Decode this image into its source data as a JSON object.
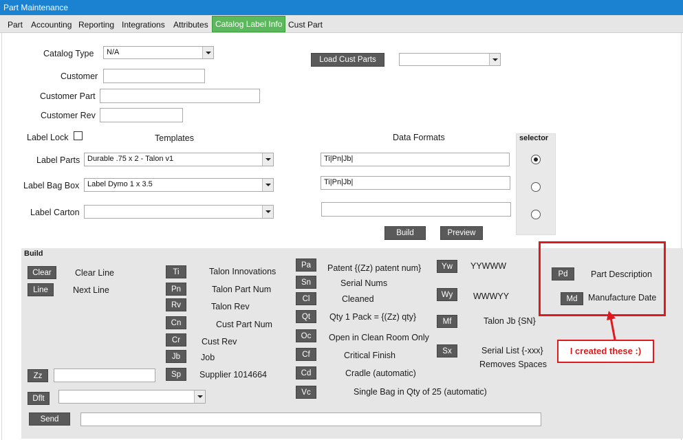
{
  "window": {
    "title": "Part Maintenance"
  },
  "tabs": [
    {
      "label": "Part"
    },
    {
      "label": "Accounting"
    },
    {
      "label": "Reporting"
    },
    {
      "label": "Integrations"
    },
    {
      "label": "Attributes"
    },
    {
      "label": "Catalog Label Info",
      "active": true
    },
    {
      "label": "Cust Part"
    }
  ],
  "form": {
    "catalog_type": {
      "label": "Catalog Type",
      "value": "N/A"
    },
    "customer": {
      "label": "Customer",
      "value": ""
    },
    "customer_part": {
      "label": "Customer Part",
      "value": ""
    },
    "customer_rev": {
      "label": "Customer Rev",
      "value": ""
    },
    "load_cust_parts": {
      "label": "Load Cust Parts",
      "value": ""
    },
    "label_lock": {
      "label": "Label Lock",
      "checked": false
    },
    "templates_header": "Templates",
    "data_formats_header": "Data Formats",
    "selector_header": "selector",
    "label_parts": {
      "label": "Label Parts",
      "template": "Durable .75 x 2 - Talon v1",
      "format": "Ti|Pn|Jb|"
    },
    "label_bag_box": {
      "label": "Label Bag Box",
      "template": "Label Dymo 1 x 3.5",
      "format": "Ti|Pn|Jb|"
    },
    "label_carton": {
      "label": "Label Carton",
      "template": "",
      "format": ""
    },
    "selected_index": 0,
    "build_button": "Build",
    "preview_button": "Preview"
  },
  "build": {
    "title": "Build",
    "col1": [
      {
        "code": "Clear",
        "desc": "Clear Line"
      },
      {
        "code": "Line",
        "desc": "Next Line"
      }
    ],
    "col2": [
      {
        "code": "Ti",
        "desc": "Talon Innovations"
      },
      {
        "code": "Pn",
        "desc": "Talon Part Num"
      },
      {
        "code": "Rv",
        "desc": "Talon Rev"
      },
      {
        "code": "Cn",
        "desc": "Cust Part Num"
      },
      {
        "code": "Cr",
        "desc": "Cust Rev"
      },
      {
        "code": "Jb",
        "desc": "Job"
      },
      {
        "code": "Sp",
        "desc": "Supplier 1014664"
      }
    ],
    "col3": [
      {
        "code": "Pa",
        "desc": "Patent {(Zz) patent num}"
      },
      {
        "code": "Sn",
        "desc": "Serial Nums"
      },
      {
        "code": "Cl",
        "desc": "Cleaned"
      },
      {
        "code": "Qt",
        "desc": "Qty 1 Pack = {(Zz) qty}"
      },
      {
        "code": "Oc",
        "desc": "Open in Clean Room Only"
      },
      {
        "code": "Cf",
        "desc": "Critical Finish"
      },
      {
        "code": "Cd",
        "desc": "Cradle (automatic)"
      },
      {
        "code": "Vc",
        "desc": "Single Bag in Qty of 25 (automatic)"
      }
    ],
    "col4": [
      {
        "code": "Yw",
        "desc": "YYWWW"
      },
      {
        "code": "Wy",
        "desc": "WWWYY"
      },
      {
        "code": "Mf",
        "desc": "Talon Jb {SN}"
      },
      {
        "code": "Sx",
        "desc": "Serial List {-xxx}",
        "desc2": "Removes Spaces"
      }
    ],
    "col5": [
      {
        "code": "Pd",
        "desc": "Part Description"
      },
      {
        "code": "Md",
        "desc": "Manufacture Date"
      }
    ],
    "zz": {
      "code": "Zz",
      "value": ""
    },
    "dflt": {
      "code": "Dflt",
      "value": ""
    },
    "send": {
      "code": "Send",
      "value": ""
    }
  },
  "annotation": {
    "text": "I created these :)",
    "color": "#e0191c"
  }
}
